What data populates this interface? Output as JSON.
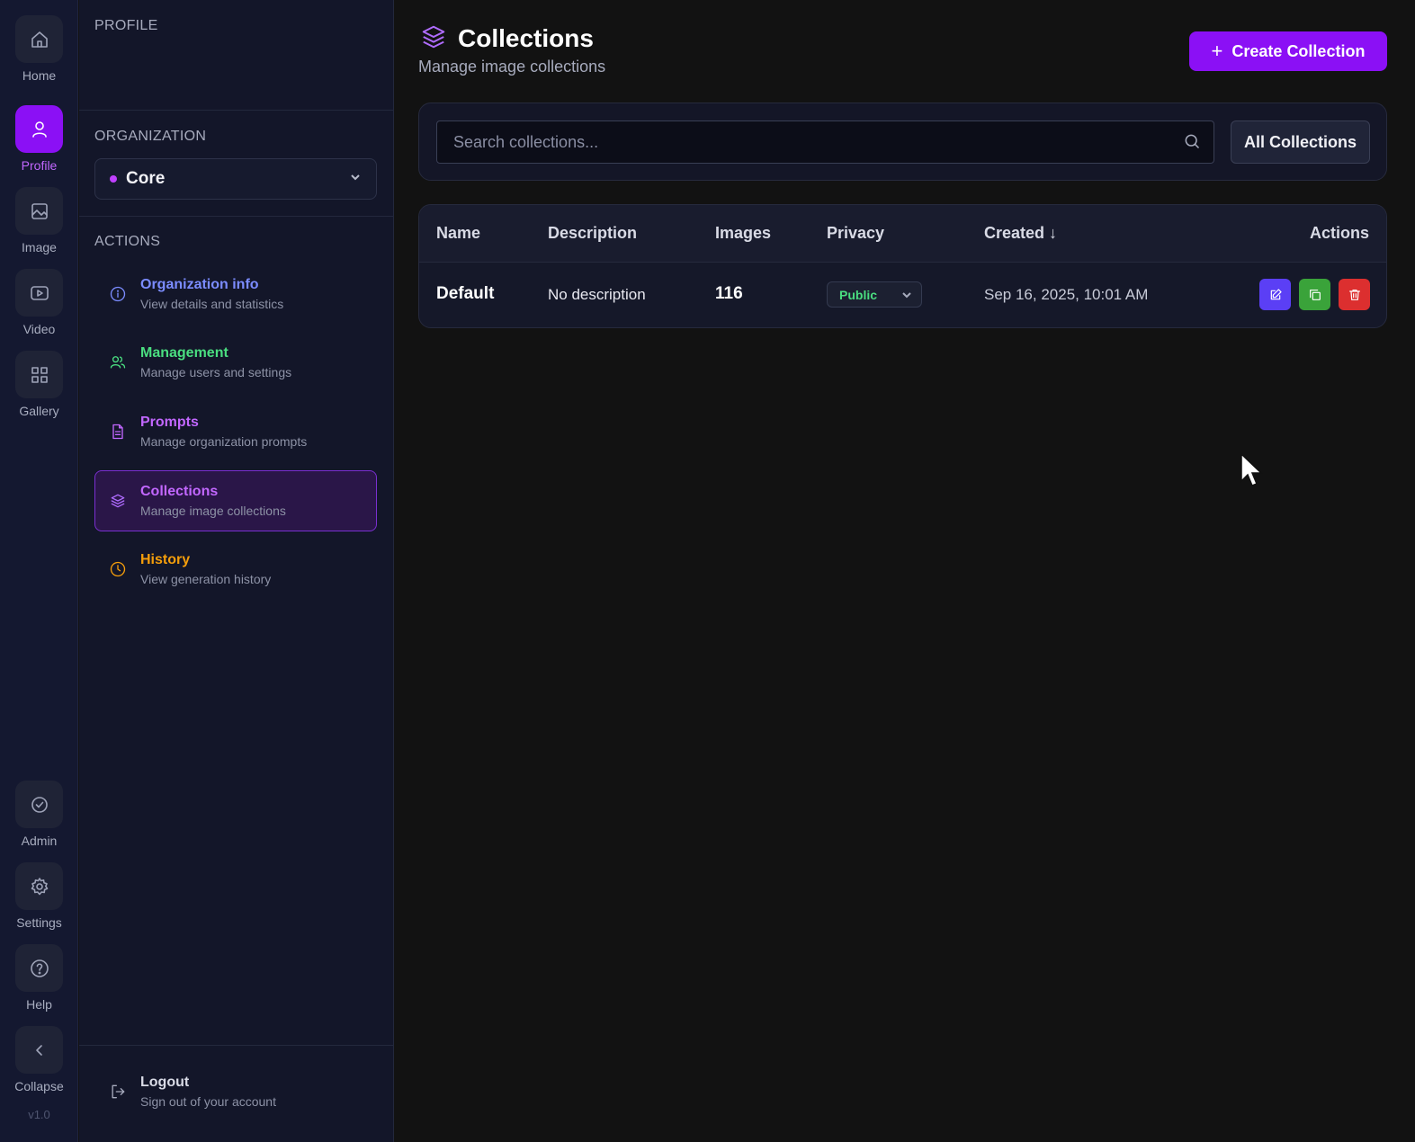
{
  "rail": {
    "items": [
      {
        "label": "Home",
        "icon": "home-icon"
      },
      {
        "label": "Profile",
        "icon": "user-icon",
        "active": true
      },
      {
        "label": "Image",
        "icon": "image-icon"
      },
      {
        "label": "Video",
        "icon": "video-icon"
      },
      {
        "label": "Gallery",
        "icon": "grid-icon"
      }
    ],
    "bottom_items": [
      {
        "label": "Admin",
        "icon": "badge-check-icon"
      },
      {
        "label": "Settings",
        "icon": "gear-icon"
      },
      {
        "label": "Help",
        "icon": "help-icon"
      },
      {
        "label": "Collapse",
        "icon": "chevron-left-icon"
      }
    ],
    "version": "v1.0"
  },
  "panel": {
    "profile_title": "PROFILE",
    "organization_title": "ORGANIZATION",
    "organization_selected": "Core",
    "actions_title": "ACTIONS",
    "actions": [
      {
        "title": "Organization info",
        "subtitle": "View details and statistics",
        "color": "#7b8cff"
      },
      {
        "title": "Management",
        "subtitle": "Manage users and settings",
        "color": "#4ade80"
      },
      {
        "title": "Prompts",
        "subtitle": "Manage organization prompts",
        "color": "#c267ff"
      },
      {
        "title": "Collections",
        "subtitle": "Manage image collections",
        "color": "#c267ff",
        "active": true
      },
      {
        "title": "History",
        "subtitle": "View generation history",
        "color": "#f59e0b"
      }
    ],
    "logout": {
      "title": "Logout",
      "subtitle": "Sign out of your account"
    }
  },
  "main": {
    "title": "Collections",
    "subtitle": "Manage image collections",
    "create_button": "Create Collection",
    "search_placeholder": "Search collections...",
    "filter_button": "All Collections",
    "table": {
      "headers": {
        "name": "Name",
        "description": "Description",
        "images": "Images",
        "privacy": "Privacy",
        "created": "Created ↓",
        "actions": "Actions"
      },
      "rows": [
        {
          "name": "Default",
          "description": "No description",
          "images": "116",
          "privacy": "Public",
          "created": "Sep 16, 2025, 10:01 AM"
        }
      ]
    }
  },
  "colors": {
    "accent": "#8b10f5",
    "edit": "#5b3ff5",
    "duplicate": "#3aa33a",
    "delete": "#dc2f2f",
    "public": "#4ade80"
  }
}
